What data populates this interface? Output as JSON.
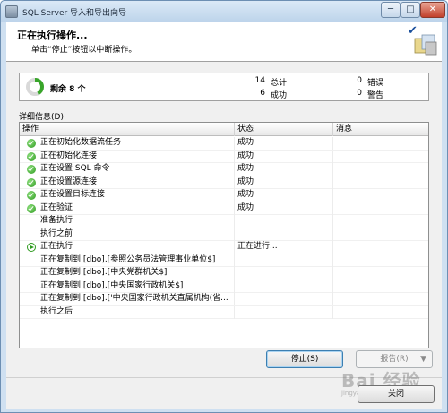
{
  "window": {
    "title": "SQL Server 导入和导出向导",
    "controls": {
      "minimize": "─",
      "maximize": "□",
      "close": "✕"
    }
  },
  "header": {
    "title": "正在执行操作...",
    "subtitle": "单击“停止”按钮以中断操作。"
  },
  "summary": {
    "remaining_label": "剩余 8 个",
    "total_count": "14",
    "total_label": "总计",
    "success_count": "6",
    "success_label": "成功",
    "error_count": "0",
    "error_label": "错误",
    "warning_count": "0",
    "warning_label": "警告",
    "progress_fraction": 0.43
  },
  "details": {
    "label": "详细信息(D):",
    "columns": [
      "操作",
      "状态",
      "消息"
    ],
    "rows": [
      {
        "icon": "success",
        "operation": "正在初始化数据流任务",
        "status": "成功",
        "message": ""
      },
      {
        "icon": "success",
        "operation": "正在初始化连接",
        "status": "成功",
        "message": ""
      },
      {
        "icon": "success",
        "operation": "正在设置 SQL 命令",
        "status": "成功",
        "message": ""
      },
      {
        "icon": "success",
        "operation": "正在设置源连接",
        "status": "成功",
        "message": ""
      },
      {
        "icon": "success",
        "operation": "正在设置目标连接",
        "status": "成功",
        "message": ""
      },
      {
        "icon": "success",
        "operation": "正在验证",
        "status": "成功",
        "message": ""
      },
      {
        "icon": "none",
        "operation": "准备执行",
        "status": "",
        "message": ""
      },
      {
        "icon": "none",
        "operation": "执行之前",
        "status": "",
        "message": ""
      },
      {
        "icon": "running",
        "operation": "正在执行",
        "status": "正在进行...",
        "message": ""
      },
      {
        "icon": "none",
        "operation": "正在复制到 [dbo].[参照公务员法管理事业单位$]",
        "status": "",
        "message": ""
      },
      {
        "icon": "none",
        "operation": "正在复制到 [dbo].[中央党群机关$]",
        "status": "",
        "message": ""
      },
      {
        "icon": "none",
        "operation": "正在复制到 [dbo].[中央国家行政机关$]",
        "status": "",
        "message": ""
      },
      {
        "icon": "none",
        "operation": "正在复制到 [dbo].['中央国家行政机关直属机构(省...",
        "status": "",
        "message": ""
      },
      {
        "icon": "none",
        "operation": "执行之后",
        "status": "",
        "message": ""
      }
    ]
  },
  "buttons": {
    "stop": "停止(S)",
    "report": "报告(R)",
    "report_arrow": "▼",
    "close": "关闭"
  },
  "watermark": {
    "text": "Bai 经验",
    "sub": "jingyan.baidu.com"
  },
  "colors": {
    "success": "#2e9a1f",
    "accent": "#1b4f9c"
  }
}
